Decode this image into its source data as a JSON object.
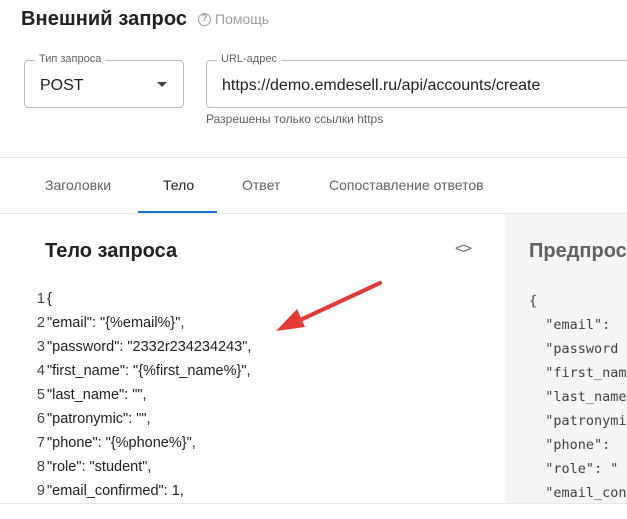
{
  "header": {
    "title": "Внешний запрос",
    "help_label": "Помощь"
  },
  "request_type": {
    "label": "Тип запроса",
    "value": "POST"
  },
  "url": {
    "label": "URL-адрес",
    "value": "https://demo.emdesell.ru/api/accounts/create",
    "hint": "Разрешены только ссылки https"
  },
  "tabs": [
    {
      "label": "Заголовки",
      "active": false
    },
    {
      "label": "Тело",
      "active": true
    },
    {
      "label": "Ответ",
      "active": false
    },
    {
      "label": "Сопоставление ответов",
      "active": false
    }
  ],
  "body_panel": {
    "title": "Тело запроса",
    "toggle_icon": "code-icon",
    "lines": [
      {
        "num": "1",
        "code": "{"
      },
      {
        "num": "2",
        "code": "\"email\": \"{%email%}\","
      },
      {
        "num": "3",
        "code": "\"password\": \"2332r234234243\","
      },
      {
        "num": "4",
        "code": "\"first_name\": \"{%first_name%}\","
      },
      {
        "num": "5",
        "code": "\"last_name\": \"\","
      },
      {
        "num": "6",
        "code": "\"patronymic\": \"\","
      },
      {
        "num": "7",
        "code": "\"phone\": \"{%phone%}\","
      },
      {
        "num": "8",
        "code": "\"role\": \"student\","
      },
      {
        "num": "9",
        "code": "\"email_confirmed\": 1,"
      }
    ]
  },
  "preview_panel": {
    "title": "Предпросм",
    "lines": [
      "{",
      "  \"email\": ",
      "  \"password",
      "  \"first_nam",
      "  \"last_name",
      "  \"patronymi",
      "  \"phone\": ",
      "  \"role\": \"",
      "  \"email_con"
    ]
  },
  "colors": {
    "accent": "#1976d2",
    "annotation_arrow": "#e53935"
  }
}
